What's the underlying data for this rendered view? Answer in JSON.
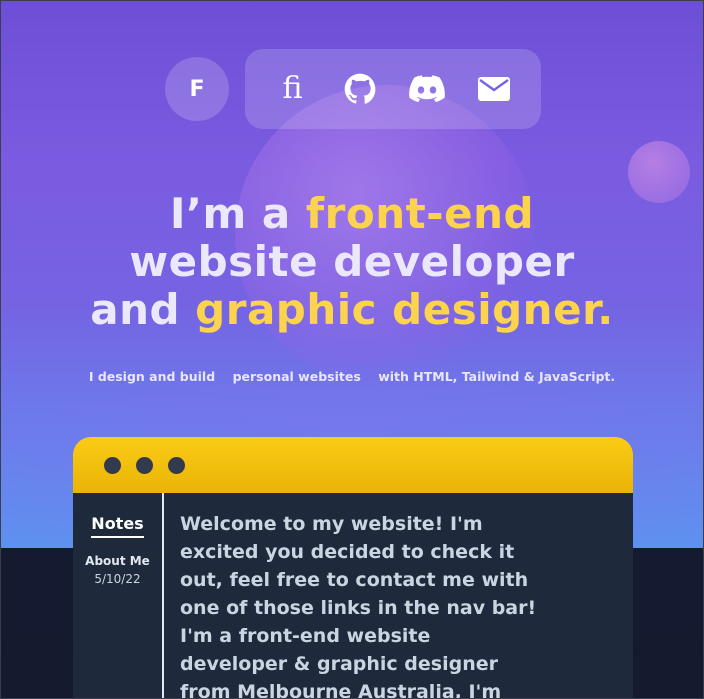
{
  "nav": {
    "avatar_letter": "F",
    "links": [
      {
        "icon": "fiverr-logo-icon",
        "glyph": "fi"
      },
      {
        "icon": "github-icon"
      },
      {
        "icon": "discord-icon"
      },
      {
        "icon": "mail-icon"
      }
    ]
  },
  "hero": {
    "line1_a": "I’m a ",
    "line1_b": "front-end",
    "line2": "website developer",
    "line3_a": "and ",
    "line3_b": "graphic designer.",
    "sub_a": "I design and build",
    "sub_b": "personal websites",
    "sub_c": "with HTML, Tailwind & JavaScript."
  },
  "window": {
    "sidebar_title": "Notes",
    "note_title": "About Me",
    "note_date": "5/10/22",
    "body_text": "Welcome to my website! I'm excited you decided to check it out, feel free to contact me with one of those links in the nav bar! I'm a front-end website developer & graphic designer from Melbourne Australia, I'm currently working on learning"
  },
  "colors": {
    "accent_yellow": "#fcd34d",
    "window_bar": "#facc15",
    "window_body": "#1e293b",
    "hero_top": "#6d4fd6",
    "hero_bottom": "#5e91f0"
  }
}
